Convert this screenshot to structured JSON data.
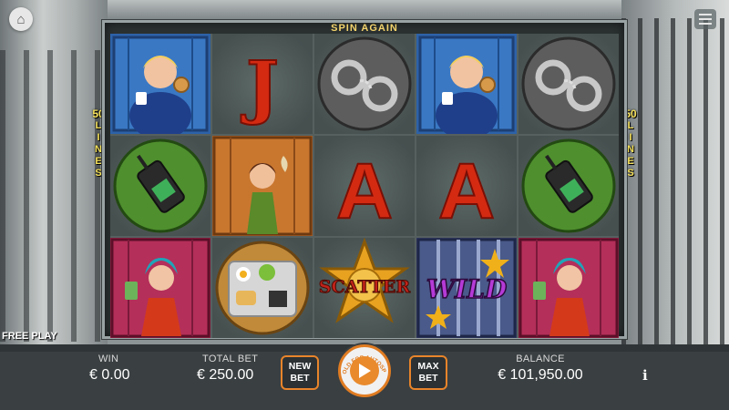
{
  "top": {
    "title": "SPIN AGAIN",
    "home_icon": "home-icon",
    "menu_icon": "hamburger-menu-icon"
  },
  "lines": {
    "count": "50",
    "label": "LINES"
  },
  "reels": [
    [
      "guard",
      "J",
      "handcuffs",
      "guard",
      "handcuffs"
    ],
    [
      "walkie-talkie",
      "inmate-girl",
      "A",
      "A",
      "walkie-talkie"
    ],
    [
      "money-lady",
      "prison-tray",
      "scatter-badge",
      "wild",
      "money-lady"
    ]
  ],
  "symbols": {
    "J": "J",
    "A": "A",
    "scatter": "SCATTER",
    "wild": "WILD"
  },
  "free_play_label": "FREE PLAY",
  "bottom": {
    "win_label": "WIN",
    "win_value": "€ 0.00",
    "total_bet_label": "TOTAL BET",
    "total_bet_value": "€ 250.00",
    "new_bet_label": "NEW BET",
    "max_bet_label": "MAX BET",
    "hold_for_autospin": "HOLD FOR AUTOSPIN",
    "balance_label": "BALANCE",
    "balance_value": "€ 101,950.00",
    "info_label": "i"
  },
  "colors": {
    "accent_orange": "#e8842a",
    "title_gold": "#f3d36b",
    "lines_yellow": "#f4e05a",
    "letter_red": "#d42a12"
  }
}
